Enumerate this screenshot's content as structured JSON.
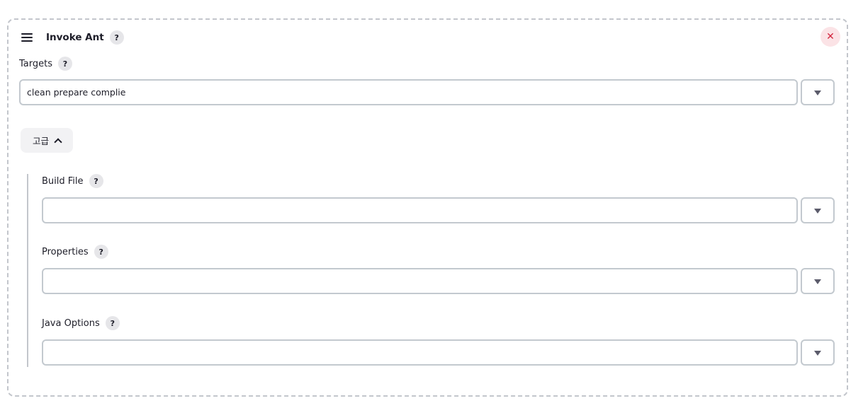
{
  "step": {
    "title": "Invoke Ant",
    "help_glyph": "?",
    "close_glyph": "✕",
    "drag_icon": "hamburger-icon"
  },
  "targets": {
    "label": "Targets",
    "value": "clean prepare complie",
    "placeholder": ""
  },
  "advanced": {
    "label": "고급",
    "expanded": true
  },
  "build_file": {
    "label": "Build File",
    "value": ""
  },
  "properties": {
    "label": "Properties",
    "value": ""
  },
  "java_options": {
    "label": "Java Options",
    "value": ""
  },
  "colors": {
    "close": "#d3263f",
    "close_bg": "#fbe3e6",
    "border": "#c3c9cf"
  }
}
